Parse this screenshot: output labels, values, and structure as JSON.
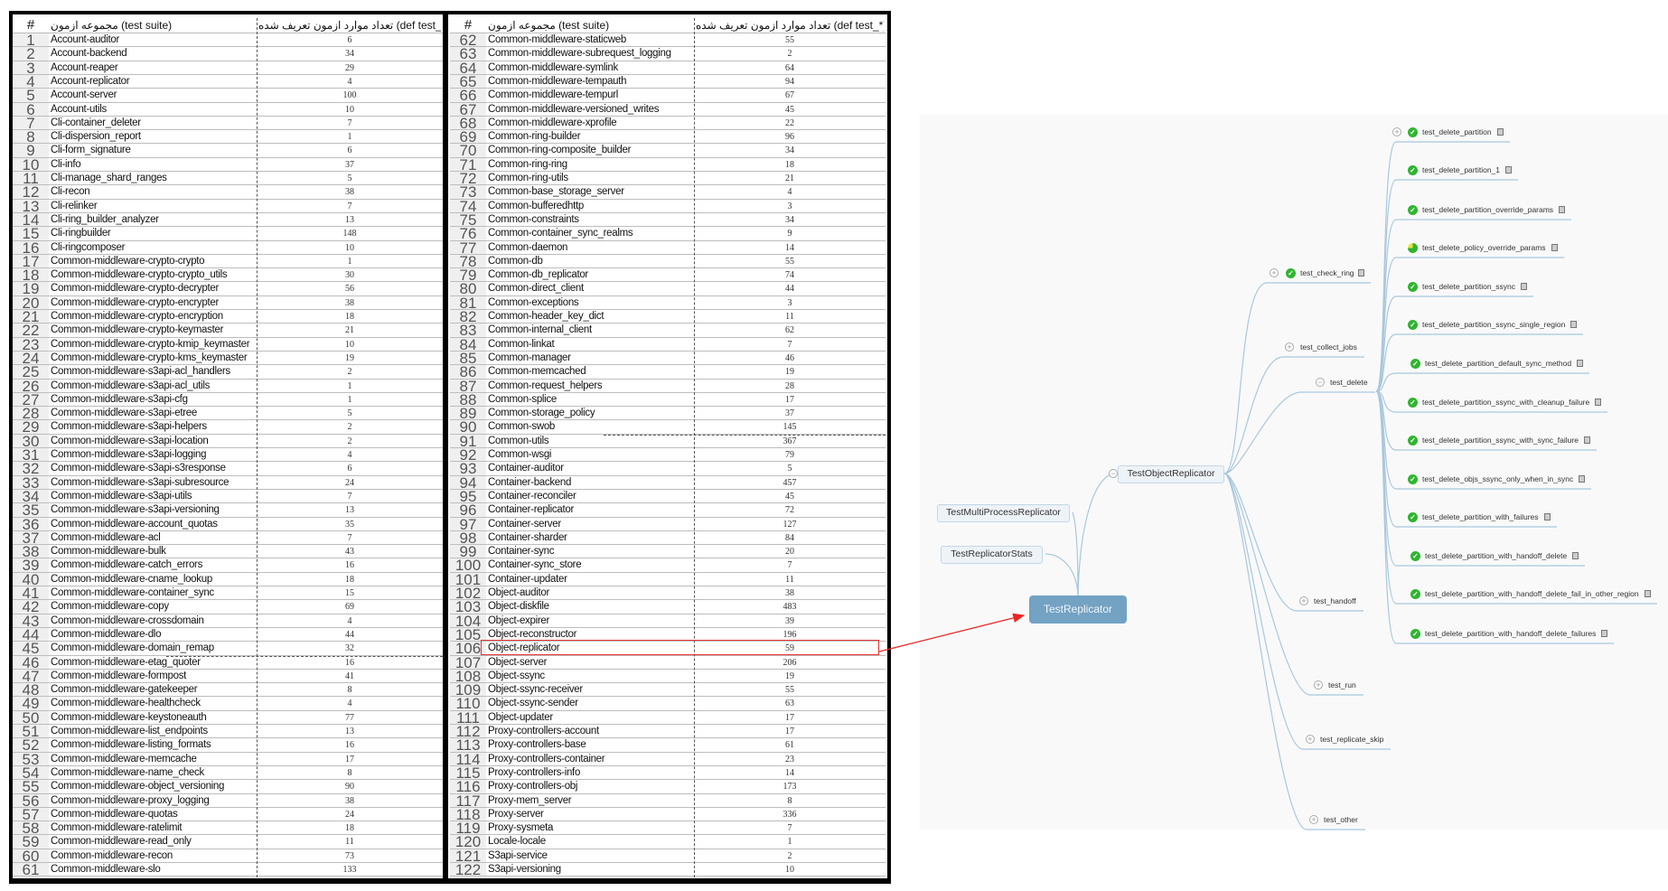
{
  "table": {
    "headers": {
      "num": "#",
      "suite": "مجموعه ازمون (test suite)",
      "count": "تعداد موارد ازمون تعریف شده (def test_*)"
    },
    "rows": [
      [
        1,
        "Account-auditor",
        6
      ],
      [
        2,
        "Account-backend",
        34
      ],
      [
        3,
        "Account-reaper",
        29
      ],
      [
        4,
        "Account-replicator",
        4
      ],
      [
        5,
        "Account-server",
        100
      ],
      [
        6,
        "Account-utils",
        10
      ],
      [
        7,
        "Cli-container_deleter",
        7
      ],
      [
        8,
        "Cli-dispersion_report",
        1
      ],
      [
        9,
        "Cli-form_signature",
        6
      ],
      [
        10,
        "Cli-info",
        37
      ],
      [
        11,
        "Cli-manage_shard_ranges",
        5
      ],
      [
        12,
        "Cli-recon",
        38
      ],
      [
        13,
        "Cli-relinker",
        7
      ],
      [
        14,
        "Cli-ring_builder_analyzer",
        13
      ],
      [
        15,
        "Cli-ringbuilder",
        148
      ],
      [
        16,
        "Cli-ringcomposer",
        10
      ],
      [
        17,
        "Common-middleware-crypto-crypto",
        1
      ],
      [
        18,
        "Common-middleware-crypto-crypto_utils",
        30
      ],
      [
        19,
        "Common-middleware-crypto-decrypter",
        56
      ],
      [
        20,
        "Common-middleware-crypto-encrypter",
        38
      ],
      [
        21,
        "Common-middleware-crypto-encryption",
        18
      ],
      [
        22,
        "Common-middleware-crypto-keymaster",
        21
      ],
      [
        23,
        "Common-middleware-crypto-kmip_keymaster",
        10
      ],
      [
        24,
        "Common-middleware-crypto-kms_keymaster",
        19
      ],
      [
        25,
        "Common-middleware-s3api-acl_handlers",
        2
      ],
      [
        26,
        "Common-middleware-s3api-acl_utils",
        1
      ],
      [
        27,
        "Common-middleware-s3api-cfg",
        1
      ],
      [
        28,
        "Common-middleware-s3api-etree",
        5
      ],
      [
        29,
        "Common-middleware-s3api-helpers",
        2
      ],
      [
        30,
        "Common-middleware-s3api-location",
        2
      ],
      [
        31,
        "Common-middleware-s3api-logging",
        4
      ],
      [
        32,
        "Common-middleware-s3api-s3response",
        6
      ],
      [
        33,
        "Common-middleware-s3api-subresource",
        24
      ],
      [
        34,
        "Common-middleware-s3api-utils",
        7
      ],
      [
        35,
        "Common-middleware-s3api-versioning",
        13
      ],
      [
        36,
        "Common-middleware-account_quotas",
        35
      ],
      [
        37,
        "Common-middleware-acl",
        7
      ],
      [
        38,
        "Common-middleware-bulk",
        43
      ],
      [
        39,
        "Common-middleware-catch_errors",
        16
      ],
      [
        40,
        "Common-middleware-cname_lookup",
        18
      ],
      [
        41,
        "Common-middleware-container_sync",
        15
      ],
      [
        42,
        "Common-middleware-copy",
        69
      ],
      [
        43,
        "Common-middleware-crossdomain",
        4
      ],
      [
        44,
        "Common-middleware-dlo",
        44
      ],
      [
        45,
        "Common-middleware-domain_remap",
        32
      ],
      [
        46,
        "Common-middleware-etag_quoter",
        16
      ],
      [
        47,
        "Common-middleware-formpost",
        41
      ],
      [
        48,
        "Common-middleware-gatekeeper",
        8
      ],
      [
        49,
        "Common-middleware-healthcheck",
        4
      ],
      [
        50,
        "Common-middleware-keystoneauth",
        77
      ],
      [
        51,
        "Common-middleware-list_endpoints",
        13
      ],
      [
        52,
        "Common-middleware-listing_formats",
        16
      ],
      [
        53,
        "Common-middleware-memcache",
        17
      ],
      [
        54,
        "Common-middleware-name_check",
        8
      ],
      [
        55,
        "Common-middleware-object_versioning",
        90
      ],
      [
        56,
        "Common-middleware-proxy_logging",
        38
      ],
      [
        57,
        "Common-middleware-quotas",
        24
      ],
      [
        58,
        "Common-middleware-ratelimit",
        18
      ],
      [
        59,
        "Common-middleware-read_only",
        11
      ],
      [
        60,
        "Common-middleware-recon",
        73
      ],
      [
        61,
        "Common-middleware-slo",
        133
      ],
      [
        62,
        "Common-middleware-staticweb",
        55
      ],
      [
        63,
        "Common-middleware-subrequest_logging",
        2
      ],
      [
        64,
        "Common-middleware-symlink",
        64
      ],
      [
        65,
        "Common-middleware-tempauth",
        94
      ],
      [
        66,
        "Common-middleware-tempurl",
        67
      ],
      [
        67,
        "Common-middleware-versioned_writes",
        45
      ],
      [
        68,
        "Common-middleware-xprofile",
        22
      ],
      [
        69,
        "Common-ring-builder",
        96
      ],
      [
        70,
        "Common-ring-composite_builder",
        34
      ],
      [
        71,
        "Common-ring-ring",
        18
      ],
      [
        72,
        "Common-ring-utils",
        21
      ],
      [
        73,
        "Common-base_storage_server",
        4
      ],
      [
        74,
        "Common-bufferedhttp",
        3
      ],
      [
        75,
        "Common-constraints",
        34
      ],
      [
        76,
        "Common-container_sync_realms",
        9
      ],
      [
        77,
        "Common-daemon",
        14
      ],
      [
        78,
        "Common-db",
        55
      ],
      [
        79,
        "Common-db_replicator",
        74
      ],
      [
        80,
        "Common-direct_client",
        44
      ],
      [
        81,
        "Common-exceptions",
        3
      ],
      [
        82,
        "Common-header_key_dict",
        11
      ],
      [
        83,
        "Common-internal_client",
        62
      ],
      [
        84,
        "Common-linkat",
        7
      ],
      [
        85,
        "Common-manager",
        46
      ],
      [
        86,
        "Common-memcached",
        19
      ],
      [
        87,
        "Common-request_helpers",
        28
      ],
      [
        88,
        "Common-splice",
        17
      ],
      [
        89,
        "Common-storage_policy",
        37
      ],
      [
        90,
        "Common-swob",
        145
      ],
      [
        91,
        "Common-utils",
        367
      ],
      [
        92,
        "Common-wsgi",
        79
      ],
      [
        93,
        "Container-auditor",
        5
      ],
      [
        94,
        "Container-backend",
        457
      ],
      [
        95,
        "Container-reconciler",
        45
      ],
      [
        96,
        "Container-replicator",
        72
      ],
      [
        97,
        "Container-server",
        127
      ],
      [
        98,
        "Container-sharder",
        84
      ],
      [
        99,
        "Container-sync",
        20
      ],
      [
        100,
        "Container-sync_store",
        7
      ],
      [
        101,
        "Container-updater",
        11
      ],
      [
        102,
        "Object-auditor",
        38
      ],
      [
        103,
        "Object-diskfile",
        483
      ],
      [
        104,
        "Object-expirer",
        39
      ],
      [
        105,
        "Object-reconstructor",
        196
      ],
      [
        106,
        "Object-replicator",
        59
      ],
      [
        107,
        "Object-server",
        206
      ],
      [
        108,
        "Object-ssync",
        19
      ],
      [
        109,
        "Object-ssync-receiver",
        55
      ],
      [
        110,
        "Object-ssync-sender",
        63
      ],
      [
        111,
        "Object-updater",
        17
      ],
      [
        112,
        "Proxy-controllers-account",
        17
      ],
      [
        113,
        "Proxy-controllers-base",
        61
      ],
      [
        114,
        "Proxy-controllers-container",
        23
      ],
      [
        115,
        "Proxy-controllers-info",
        14
      ],
      [
        116,
        "Proxy-controllers-obj",
        173
      ],
      [
        117,
        "Proxy-mem_server",
        8
      ],
      [
        118,
        "Proxy-server",
        336
      ],
      [
        119,
        "Proxy-sysmeta",
        7
      ],
      [
        120,
        "Locale-locale",
        1
      ],
      [
        121,
        "S3api-service",
        2
      ],
      [
        122,
        "S3api-versioning",
        10
      ]
    ],
    "highlighted_row": 106
  },
  "mindmap": {
    "root": "TestReplicator",
    "siblings": [
      "TestMultiProcessReplicator",
      "TestReplicatorStats"
    ],
    "main": "TestObjectReplicator",
    "children": [
      "test_check_ring",
      "test_collect_jobs",
      "test_delete",
      "test_handoff",
      "test_run",
      "test_replicate_skip",
      "test_other"
    ],
    "leaves": [
      "test_delete_partition",
      "test_delete_partition_1",
      "test_delete_partition_override_params",
      "test_delete_policy_override_params",
      "test_delete_partition_ssync",
      "test_delete_partition_ssync_single_region",
      "test_delete_partition_default_sync_method",
      "test_delete_partition_ssync_with_cleanup_failure",
      "test_delete_partition_ssync_with_sync_failure",
      "test_delete_objs_ssync_only_when_in_sync",
      "test_delete_partition_with_failures",
      "test_delete_partition_with_handoff_delete",
      "test_delete_partition_with_handoff_delete_fail_in_other_region",
      "test_delete_partition_with_handoff_delete_failures"
    ],
    "colors": {
      "root": "#73a2c3",
      "edge": "#9fc2d9",
      "pass": "#2fb52f",
      "annotation": "#ee2222"
    }
  }
}
